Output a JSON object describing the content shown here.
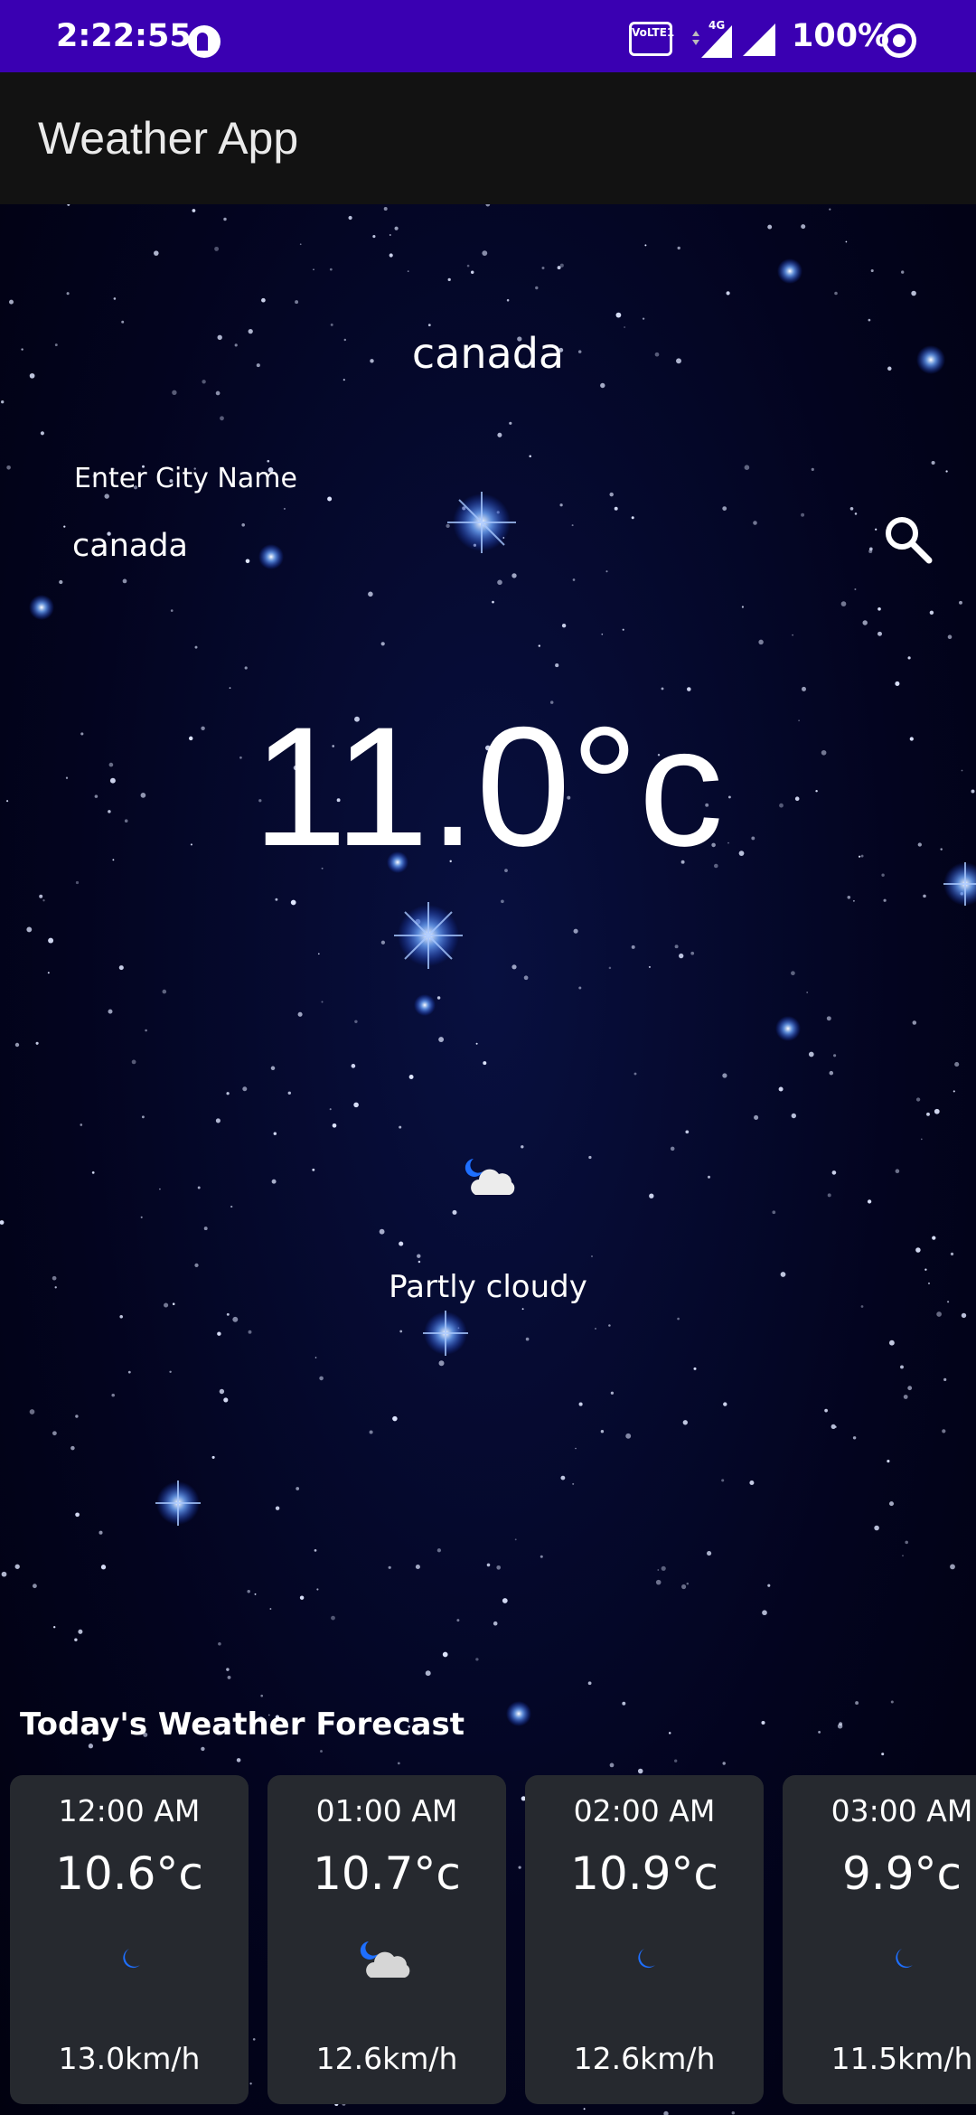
{
  "status_bar": {
    "time": "2:22:55",
    "volte_label": "VoLTE1",
    "network_label": "4G",
    "battery": "100%"
  },
  "app_bar": {
    "title": "Weather App"
  },
  "weather": {
    "city": "canada",
    "search": {
      "label": "Enter City Name",
      "value": "canada"
    },
    "temperature": "11.0°c",
    "condition_icon": "moon-cloud-icon",
    "condition": "Partly cloudy"
  },
  "forecast": {
    "title": "Today's Weather Forecast",
    "items": [
      {
        "time": "12:00 AM",
        "temp": "10.6°c",
        "icon": "moon-icon",
        "wind": "13.0km/h"
      },
      {
        "time": "01:00 AM",
        "temp": "10.7°c",
        "icon": "moon-cloud-icon",
        "wind": "12.6km/h"
      },
      {
        "time": "02:00 AM",
        "temp": "10.9°c",
        "icon": "moon-icon",
        "wind": "12.6km/h"
      },
      {
        "time": "03:00 AM",
        "temp": "9.9°c",
        "icon": "moon-icon",
        "wind": "11.5km/h"
      }
    ]
  },
  "colors": {
    "status_bar": "#3a00b2",
    "app_bar": "#121212",
    "card": "#26292f",
    "moon": "#1e6fff"
  }
}
